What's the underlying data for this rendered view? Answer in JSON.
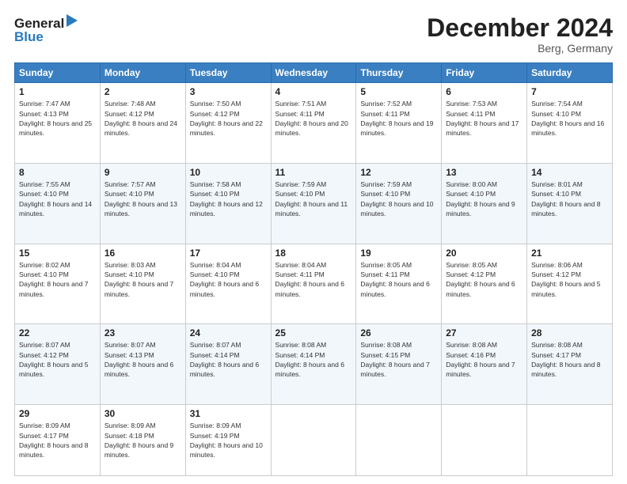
{
  "header": {
    "logo_line1": "General",
    "logo_line2": "Blue",
    "month": "December 2024",
    "location": "Berg, Germany"
  },
  "days_of_week": [
    "Sunday",
    "Monday",
    "Tuesday",
    "Wednesday",
    "Thursday",
    "Friday",
    "Saturday"
  ],
  "weeks": [
    [
      {
        "day": 1,
        "sunrise": "7:47 AM",
        "sunset": "4:13 PM",
        "daylight": "8 hours and 25 minutes."
      },
      {
        "day": 2,
        "sunrise": "7:48 AM",
        "sunset": "4:12 PM",
        "daylight": "8 hours and 24 minutes."
      },
      {
        "day": 3,
        "sunrise": "7:50 AM",
        "sunset": "4:12 PM",
        "daylight": "8 hours and 22 minutes."
      },
      {
        "day": 4,
        "sunrise": "7:51 AM",
        "sunset": "4:11 PM",
        "daylight": "8 hours and 20 minutes."
      },
      {
        "day": 5,
        "sunrise": "7:52 AM",
        "sunset": "4:11 PM",
        "daylight": "8 hours and 19 minutes."
      },
      {
        "day": 6,
        "sunrise": "7:53 AM",
        "sunset": "4:11 PM",
        "daylight": "8 hours and 17 minutes."
      },
      {
        "day": 7,
        "sunrise": "7:54 AM",
        "sunset": "4:10 PM",
        "daylight": "8 hours and 16 minutes."
      }
    ],
    [
      {
        "day": 8,
        "sunrise": "7:55 AM",
        "sunset": "4:10 PM",
        "daylight": "8 hours and 14 minutes."
      },
      {
        "day": 9,
        "sunrise": "7:57 AM",
        "sunset": "4:10 PM",
        "daylight": "8 hours and 13 minutes."
      },
      {
        "day": 10,
        "sunrise": "7:58 AM",
        "sunset": "4:10 PM",
        "daylight": "8 hours and 12 minutes."
      },
      {
        "day": 11,
        "sunrise": "7:59 AM",
        "sunset": "4:10 PM",
        "daylight": "8 hours and 11 minutes."
      },
      {
        "day": 12,
        "sunrise": "7:59 AM",
        "sunset": "4:10 PM",
        "daylight": "8 hours and 10 minutes."
      },
      {
        "day": 13,
        "sunrise": "8:00 AM",
        "sunset": "4:10 PM",
        "daylight": "8 hours and 9 minutes."
      },
      {
        "day": 14,
        "sunrise": "8:01 AM",
        "sunset": "4:10 PM",
        "daylight": "8 hours and 8 minutes."
      }
    ],
    [
      {
        "day": 15,
        "sunrise": "8:02 AM",
        "sunset": "4:10 PM",
        "daylight": "8 hours and 7 minutes."
      },
      {
        "day": 16,
        "sunrise": "8:03 AM",
        "sunset": "4:10 PM",
        "daylight": "8 hours and 7 minutes."
      },
      {
        "day": 17,
        "sunrise": "8:04 AM",
        "sunset": "4:10 PM",
        "daylight": "8 hours and 6 minutes."
      },
      {
        "day": 18,
        "sunrise": "8:04 AM",
        "sunset": "4:11 PM",
        "daylight": "8 hours and 6 minutes."
      },
      {
        "day": 19,
        "sunrise": "8:05 AM",
        "sunset": "4:11 PM",
        "daylight": "8 hours and 6 minutes."
      },
      {
        "day": 20,
        "sunrise": "8:05 AM",
        "sunset": "4:12 PM",
        "daylight": "8 hours and 6 minutes."
      },
      {
        "day": 21,
        "sunrise": "8:06 AM",
        "sunset": "4:12 PM",
        "daylight": "8 hours and 5 minutes."
      }
    ],
    [
      {
        "day": 22,
        "sunrise": "8:07 AM",
        "sunset": "4:12 PM",
        "daylight": "8 hours and 5 minutes."
      },
      {
        "day": 23,
        "sunrise": "8:07 AM",
        "sunset": "4:13 PM",
        "daylight": "8 hours and 6 minutes."
      },
      {
        "day": 24,
        "sunrise": "8:07 AM",
        "sunset": "4:14 PM",
        "daylight": "8 hours and 6 minutes."
      },
      {
        "day": 25,
        "sunrise": "8:08 AM",
        "sunset": "4:14 PM",
        "daylight": "8 hours and 6 minutes."
      },
      {
        "day": 26,
        "sunrise": "8:08 AM",
        "sunset": "4:15 PM",
        "daylight": "8 hours and 7 minutes."
      },
      {
        "day": 27,
        "sunrise": "8:08 AM",
        "sunset": "4:16 PM",
        "daylight": "8 hours and 7 minutes."
      },
      {
        "day": 28,
        "sunrise": "8:08 AM",
        "sunset": "4:17 PM",
        "daylight": "8 hours and 8 minutes."
      }
    ],
    [
      {
        "day": 29,
        "sunrise": "8:09 AM",
        "sunset": "4:17 PM",
        "daylight": "8 hours and 8 minutes."
      },
      {
        "day": 30,
        "sunrise": "8:09 AM",
        "sunset": "4:18 PM",
        "daylight": "8 hours and 9 minutes."
      },
      {
        "day": 31,
        "sunrise": "8:09 AM",
        "sunset": "4:19 PM",
        "daylight": "8 hours and 10 minutes."
      },
      null,
      null,
      null,
      null
    ]
  ]
}
